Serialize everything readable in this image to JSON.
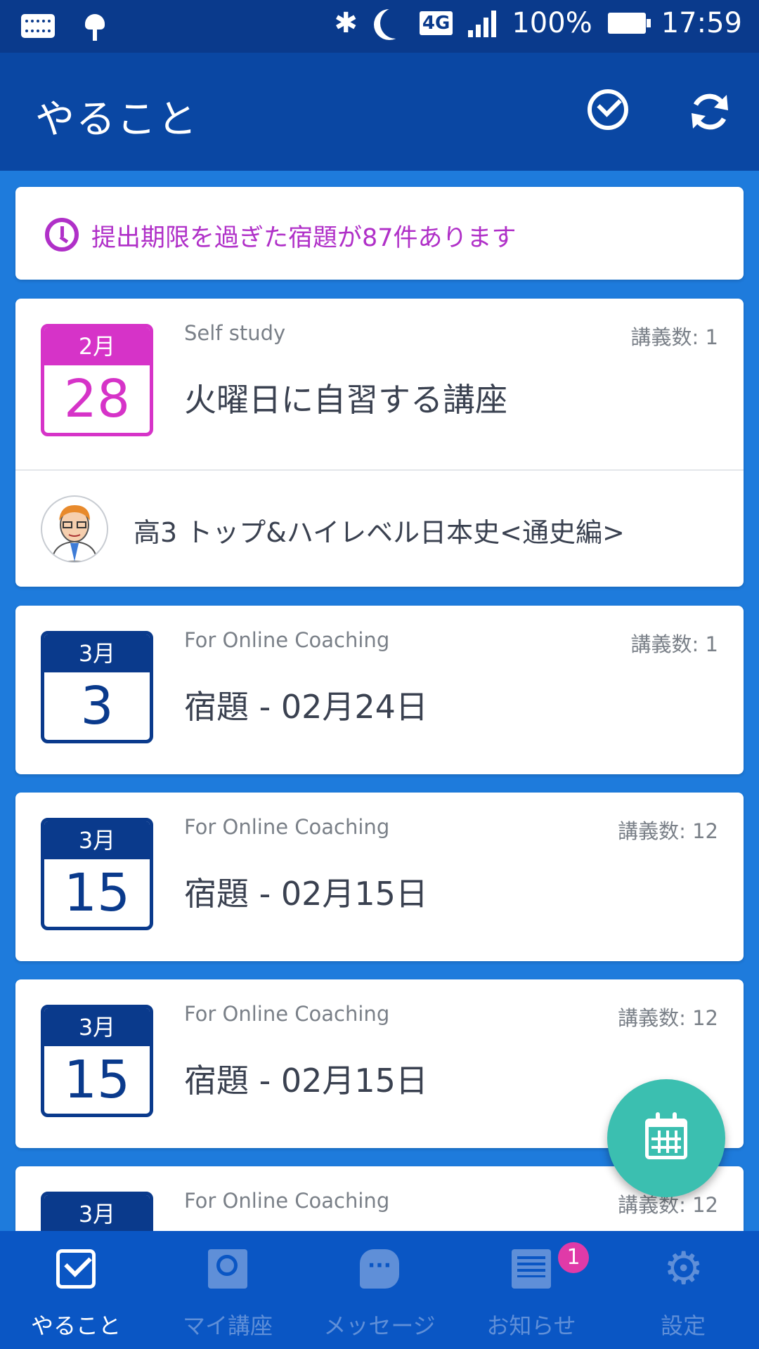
{
  "status_bar": {
    "battery": "100%",
    "time": "17:59",
    "network": "4G"
  },
  "app_bar": {
    "title": "やること"
  },
  "alert": {
    "text": "提出期限を過ぎた宿題が87件あります"
  },
  "cards": [
    {
      "month": "2月",
      "day": "28",
      "category": "Self study",
      "count": "講義数: 1",
      "title": "火曜日に自習する講座",
      "course": "高3 トップ&ハイレベル日本史<通史編>",
      "accent": "#d633c8"
    },
    {
      "month": "3月",
      "day": "3",
      "category": "For Online Coaching",
      "count": "講義数: 1",
      "title": "宿題 - 02月24日"
    },
    {
      "month": "3月",
      "day": "15",
      "category": "For Online Coaching",
      "count": "講義数: 12",
      "title": "宿題 - 02月15日"
    },
    {
      "month": "3月",
      "day": "15",
      "category": "For Online Coaching",
      "count": "講義数: 12",
      "title": "宿題 - 02月15日"
    },
    {
      "month": "3月",
      "category": "For Online Coaching",
      "count": "講義数: 12"
    }
  ],
  "bottom_nav": [
    {
      "label": "やること",
      "icon": "check-square-icon",
      "active": true
    },
    {
      "label": "マイ講座",
      "icon": "book-icon"
    },
    {
      "label": "メッセージ",
      "icon": "chat-icon"
    },
    {
      "label": "お知らせ",
      "icon": "news-icon",
      "badge": "1"
    },
    {
      "label": "設定",
      "icon": "gear-icon"
    }
  ],
  "colors": {
    "primary": "#0a47a3",
    "background": "#1e7bdc",
    "accent_pink": "#d633c8",
    "fab": "#3bbfb0"
  }
}
